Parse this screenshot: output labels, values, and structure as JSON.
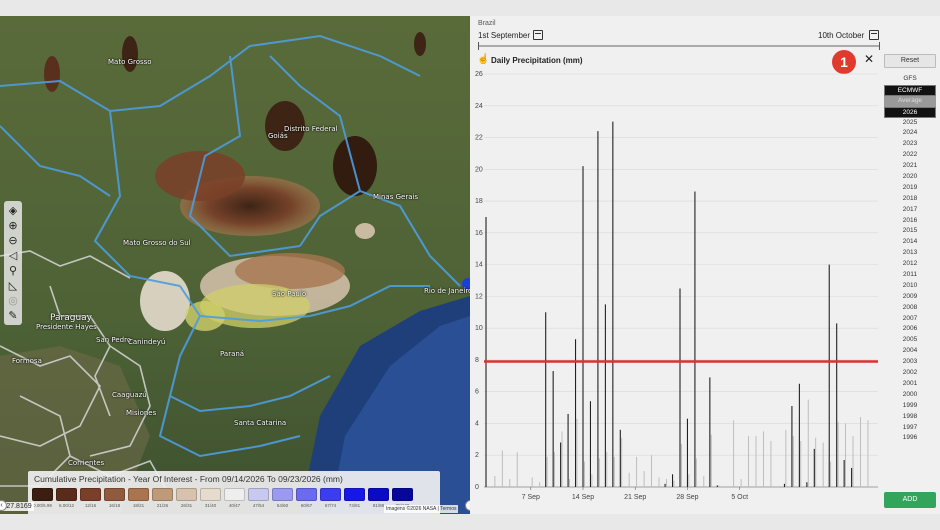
{
  "map": {
    "labels": [
      {
        "key": "mt",
        "text": "Mato Grosso"
      },
      {
        "key": "goias",
        "text": "Goiás"
      },
      {
        "key": "df",
        "text": "Distrito Federal"
      },
      {
        "key": "mg",
        "text": "Minas Gerais"
      },
      {
        "key": "ms",
        "text": "Mato Grosso do Sul"
      },
      {
        "key": "sp",
        "text": "São Paulo"
      },
      {
        "key": "rj",
        "text": "Rio de Janeiro"
      },
      {
        "key": "paraguay",
        "text": "Paraguay"
      },
      {
        "key": "ph",
        "text": "Presidente Hayes"
      },
      {
        "key": "parana",
        "text": "Paraná"
      },
      {
        "key": "sc",
        "text": "Santa Catarina"
      },
      {
        "key": "formosa",
        "text": "Formosa"
      },
      {
        "key": "corrientes",
        "text": "Corrientes"
      },
      {
        "key": "caaguazu",
        "text": "Caaguazú"
      },
      {
        "key": "sanpedro",
        "text": "San Pedro"
      },
      {
        "key": "canindeyu",
        "text": "Canindeyú"
      },
      {
        "key": "misiones",
        "text": "Misiones"
      }
    ],
    "legend": {
      "title": "Cumulative Precipitation - Year Of Interest - From 09/14/2026 To 09/23/2026 (mm)",
      "colors": [
        "#3b1d12",
        "#5a2a1b",
        "#7a3f28",
        "#8f5a3e",
        "#a8754f",
        "#bf9a78",
        "#d7c3ad",
        "#e6dccd",
        "#eeeeee",
        "#c9c9ef",
        "#9a9af2",
        "#6b6bf0",
        "#3d3df0",
        "#1717e6",
        "#0b0bc4",
        "#07079a"
      ],
      "ranges": [
        "0.00/5.99",
        "6.00/12",
        "12/16",
        "16/18",
        "18/21",
        "21/26",
        "26/31",
        "31/40",
        "40/47",
        "47/54",
        "54/60",
        "60/67",
        "67/74",
        "74/81",
        "81/88",
        "88/100"
      ]
    },
    "coordinate": "-27.8169",
    "attribution": "Imagens ©2026 NASA | Termos"
  },
  "panel": {
    "region": "Brazil",
    "start_date": "1st September",
    "end_date": "10th October",
    "chart_title": "Daily Precipitation (mm)",
    "badge": "1",
    "close": "✕",
    "reset": "Reset",
    "add": "ADD",
    "years": [
      "GFS",
      "ECMWF",
      "Average",
      "2026",
      "2025",
      "2024",
      "2023",
      "2022",
      "2021",
      "2020",
      "2019",
      "2018",
      "2017",
      "2016",
      "2015",
      "2014",
      "2013",
      "2012",
      "2011",
      "2010",
      "2009",
      "2008",
      "2007",
      "2006",
      "2005",
      "2004",
      "2003",
      "2002",
      "2001",
      "2000",
      "1999",
      "1998",
      "1997",
      "1996"
    ],
    "accent_red": "#d9342b",
    "accent_green": "#33a55a"
  },
  "chart_data": {
    "type": "bar",
    "title": "Daily Precipitation (mm)",
    "x_start": "2026-09-01",
    "x_tick_labels": [
      "7 Sep",
      "14 Sep",
      "21 Sep",
      "28 Sep",
      "5 Oct"
    ],
    "y_ticks": [
      0,
      2,
      4,
      6,
      8,
      10,
      12,
      14,
      16,
      18,
      20,
      22,
      24,
      26
    ],
    "ylim": [
      0,
      26
    ],
    "reference_line": 7.9,
    "series": [
      {
        "values": [
          17,
          0,
          0,
          0,
          0,
          0,
          0,
          0,
          11,
          7.3,
          2.8,
          4.6,
          9.3,
          20.2,
          5.4,
          22.4,
          11.5,
          23,
          3.6,
          0,
          0,
          0,
          0,
          0,
          0.2,
          0.8,
          12.5,
          4.3,
          18.6,
          0,
          6.9,
          0.1,
          0,
          0,
          0,
          0,
          0,
          0,
          0,
          0,
          0.2,
          5.1,
          6.5,
          0.3,
          2.4,
          0,
          14,
          10.3,
          1.7,
          1.2
        ]
      },
      {
        "values": [
          0,
          0.7,
          2.3,
          0.5,
          2.2,
          0,
          0.6,
          0.3,
          1.9,
          2.2,
          3.5,
          0.5,
          4.3,
          1.6,
          0.8,
          1.8,
          2.2,
          1.9,
          3.1,
          0.9,
          1.9,
          1,
          2,
          0.6,
          0.5,
          0.4,
          2.7,
          0.8,
          1.8,
          0.7,
          3.3,
          0.1,
          0,
          4.2,
          0.5,
          3.2,
          3.2,
          3.5,
          2.9,
          0,
          3.6,
          3.2,
          2.9,
          5.5,
          3.1,
          2.8,
          1.6,
          4.1,
          4,
          3.2,
          4.4,
          4.2
        ]
      }
    ]
  }
}
